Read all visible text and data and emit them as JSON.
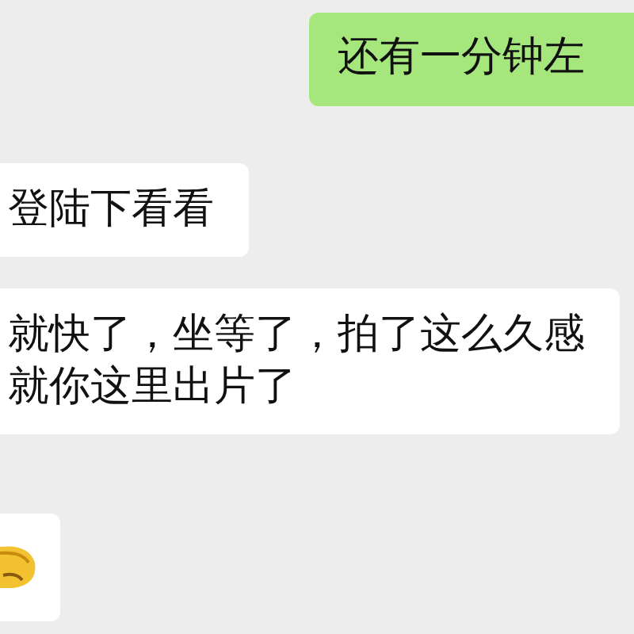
{
  "messages": [
    {
      "outgoing": true,
      "kind": "text",
      "lines": [
        "还有一分钟左"
      ]
    },
    {
      "outgoing": false,
      "kind": "text",
      "lines": [
        "登陆下看看"
      ]
    },
    {
      "outgoing": false,
      "kind": "text",
      "lines": [
        "就快了，坐等了，拍了这么久感",
        "就你这里出片了"
      ]
    },
    {
      "outgoing": false,
      "kind": "emoji"
    }
  ]
}
